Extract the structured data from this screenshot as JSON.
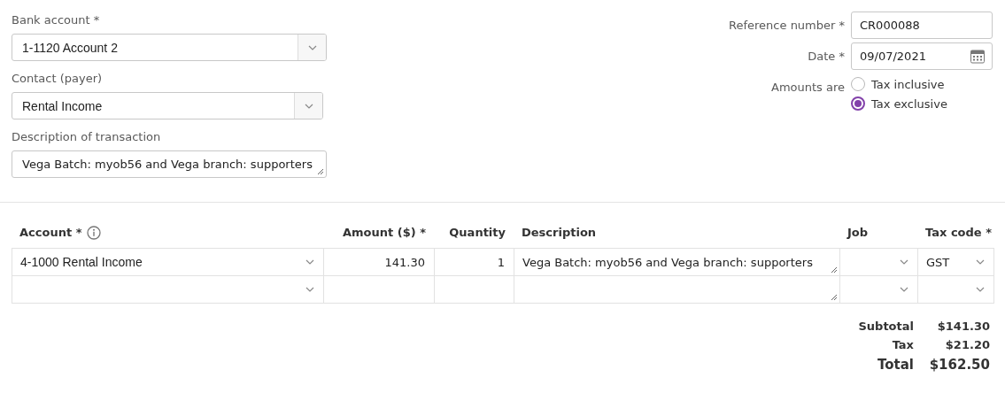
{
  "left_fields": [
    {
      "label": "Bank account *",
      "kind": "select",
      "value": "1-1120 Account 2"
    },
    {
      "label": "Contact (payer)",
      "kind": "select",
      "value": "Rental Income"
    },
    {
      "label": "Description of transaction",
      "kind": "textarea",
      "value": "Vega Batch: myob56 and Vega branch: supporters"
    }
  ],
  "right_fields": [
    {
      "label": "Reference number *",
      "kind": "text",
      "value": "CR000088"
    },
    {
      "label": "Date *",
      "kind": "date",
      "value": "09/07/2021"
    }
  ],
  "amounts_are": {
    "label": "Amounts are",
    "options": [
      {
        "label": "Tax inclusive",
        "selected": false
      },
      {
        "label": "Tax exclusive",
        "selected": true
      }
    ]
  },
  "table": {
    "columns": [
      {
        "label": "Account *",
        "kind": "select"
      },
      {
        "label": "Amount ($) *",
        "kind": "text"
      },
      {
        "label": "Quantity",
        "kind": "text"
      },
      {
        "label": "Description",
        "kind": "textarea"
      },
      {
        "label": "Job",
        "kind": "select"
      },
      {
        "label": "Tax code *",
        "kind": "select"
      }
    ],
    "rows": [
      {
        "cells": [
          "4-1000 Rental Income",
          "141.30",
          "1",
          "Vega Batch: myob56 and Vega branch: supporters",
          null,
          "GST"
        ]
      },
      {
        "cells": [
          null,
          null,
          null,
          null,
          null,
          null
        ]
      }
    ]
  },
  "totals": [
    {
      "label": "Subtotal",
      "value": "$141.30",
      "kind": "line"
    },
    {
      "label": "Tax",
      "value": "$21.20",
      "kind": "line"
    },
    {
      "label": "Total",
      "value": "$162.50",
      "kind": "grand"
    }
  ]
}
